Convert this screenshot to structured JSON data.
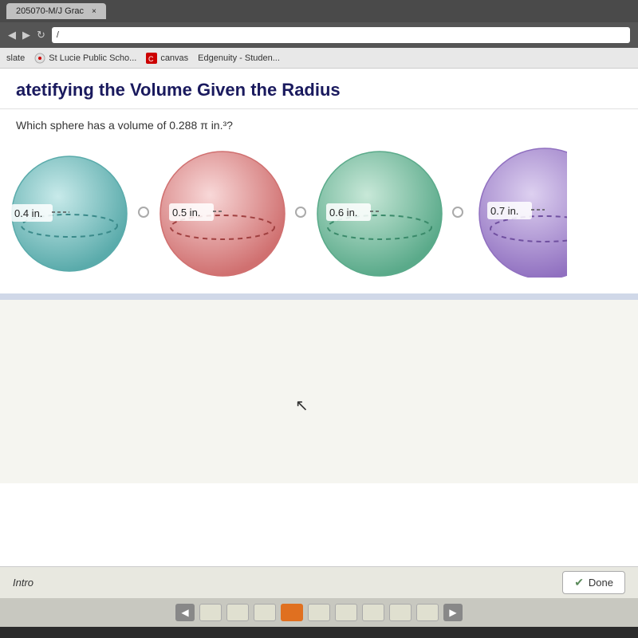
{
  "browser": {
    "tab_label": "205070-M/J Grac",
    "tab_close": "×",
    "nav_url": "/"
  },
  "bookmarks": [
    {
      "id": "slate",
      "label": "slate"
    },
    {
      "id": "stlucie",
      "label": "St Lucie Public Scho..."
    },
    {
      "id": "canvas",
      "label": "canvas"
    },
    {
      "id": "edgenuity",
      "label": "Edgenuity - Studen..."
    }
  ],
  "page": {
    "title": "tifying the Volume Given the Radius",
    "title_prefix": "ate",
    "question": "phere has a volume of 0.288 π in.³?"
  },
  "spheres": [
    {
      "id": "sphere-1",
      "radius_label": "0.4 in.",
      "color_fill": "#a8d8d8",
      "color_stroke": "#5aabab",
      "color_ellipse": "#7ec8c8",
      "selected": false
    },
    {
      "id": "sphere-2",
      "radius_label": "0.5 in.",
      "color_fill": "#f0b8b8",
      "color_stroke": "#d07070",
      "color_ellipse": "#e09090",
      "selected": false
    },
    {
      "id": "sphere-3",
      "radius_label": "0.6 in.",
      "color_fill": "#a8d8c8",
      "color_stroke": "#5aaa8a",
      "color_ellipse": "#80c8b0",
      "selected": false
    },
    {
      "id": "sphere-4",
      "radius_label": "0.7 in.",
      "color_fill": "#c8b8e8",
      "color_stroke": "#9070c0",
      "color_ellipse": "#a890d8",
      "selected": false
    }
  ],
  "footer": {
    "intro_label": "Intro",
    "done_label": "Done"
  },
  "nav_dots": {
    "total": 9,
    "active_index": 3,
    "prev_arrow": "◄",
    "next_arrow": "►"
  }
}
